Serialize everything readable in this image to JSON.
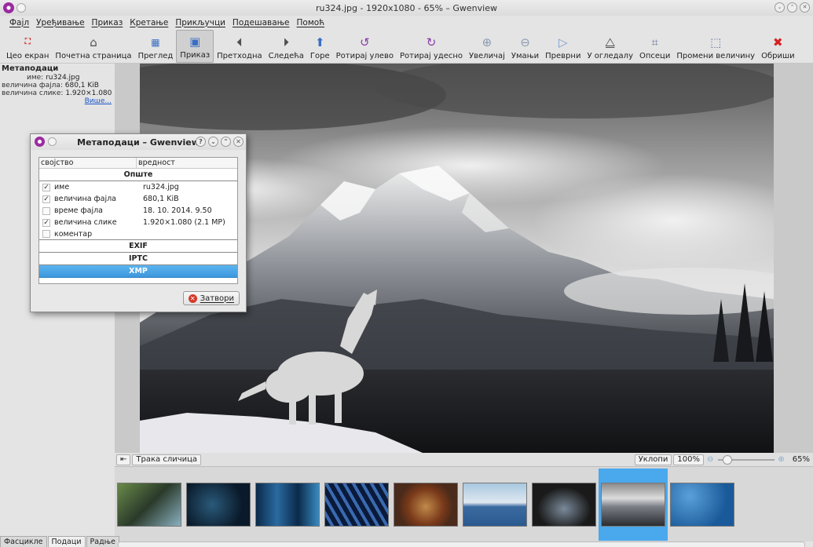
{
  "window": {
    "title": "ru324.jpg - 1920x1080 - 65% – Gwenview"
  },
  "menu": [
    "Фајл",
    "Уређивање",
    "Приказ",
    "Кретање",
    "Прикључци",
    "Подешавање",
    "Помоћ"
  ],
  "toolbar": [
    {
      "label": "Цео екран",
      "icon": "fullscreen-icon"
    },
    {
      "label": "Почетна страница",
      "icon": "home-icon"
    },
    {
      "label": "Преглед",
      "icon": "browse-icon"
    },
    {
      "label": "Приказ",
      "icon": "view-icon",
      "active": true
    },
    {
      "label": "Претходна",
      "icon": "previous-icon"
    },
    {
      "label": "Следећа",
      "icon": "next-icon"
    },
    {
      "label": "Горе",
      "icon": "up-icon"
    },
    {
      "label": "Ротирај улево",
      "icon": "rotate-left-icon"
    },
    {
      "label": "Ротирај удесно",
      "icon": "rotate-right-icon"
    },
    {
      "label": "Увеличај",
      "icon": "zoom-in-icon"
    },
    {
      "label": "Умањи",
      "icon": "zoom-out-icon"
    },
    {
      "label": "Преврни",
      "icon": "flip-icon"
    },
    {
      "label": "У огледалу",
      "icon": "mirror-icon"
    },
    {
      "label": "Опсеци",
      "icon": "crop-icon"
    },
    {
      "label": "Промени величину",
      "icon": "resize-icon"
    },
    {
      "label": "Обриши",
      "icon": "delete-icon"
    }
  ],
  "sidepanel": {
    "title": "Метаподаци",
    "lines": [
      {
        "key": "име:",
        "value": "ru324.jpg"
      },
      {
        "key": "величина фајла:",
        "value": "680,1 KiB"
      },
      {
        "key": "величина слике:",
        "value": "1.920×1.080 (2"
      }
    ],
    "more_link": "Више..."
  },
  "viewbar": {
    "toggle_label": "Трака сличица",
    "fit_label": "Уклопи",
    "zoom_value": "100%",
    "zoom_percent": "65%"
  },
  "bottom_tabs": [
    "Фасцикле",
    "Подаци",
    "Радње"
  ],
  "dialog": {
    "title": "Метаподаци – Gwenview",
    "col_property": "својство",
    "col_value": "вредност",
    "group_general": "Опште",
    "rows": [
      {
        "key": "име",
        "value": "ru324.jpg",
        "checked": true
      },
      {
        "key": "величина фајла",
        "value": "680,1 KiB",
        "checked": true
      },
      {
        "key": "време фајла",
        "value": "18. 10. 2014. 9.50",
        "checked": false
      },
      {
        "key": "величина слике",
        "value": "1.920×1.080 (2.1 MP)",
        "checked": true
      },
      {
        "key": "коментар",
        "value": "",
        "checked": false
      }
    ],
    "groups": [
      "EXIF",
      "IPTC",
      "XMP"
    ],
    "close_label": "Затвори"
  },
  "colors": {
    "selection": "#4aa8ec",
    "accent": "#3c98dc"
  }
}
